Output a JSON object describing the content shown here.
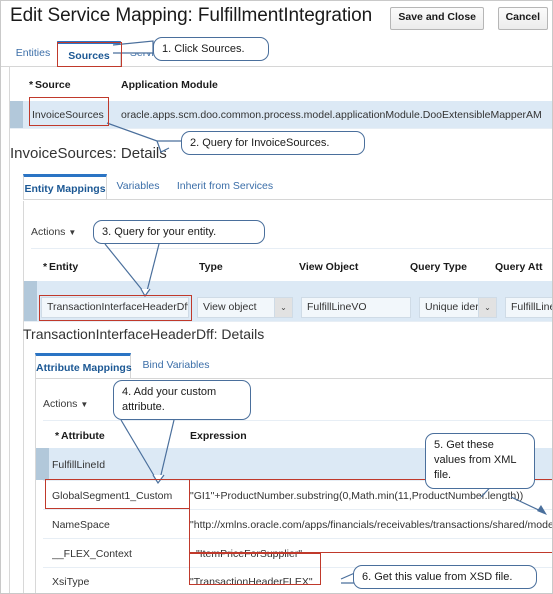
{
  "header": {
    "title": "Edit Service Mapping: FulfillmentIntegration",
    "save_label": "Save and Close",
    "cancel_label": "Cancel"
  },
  "main_tabs": [
    {
      "label": "Entities",
      "selected": false
    },
    {
      "label": "Sources",
      "selected": true
    },
    {
      "label": "Services",
      "selected": false
    }
  ],
  "sources_grid": {
    "headers": {
      "star": "*",
      "source": "Source",
      "application_module": "Application Module"
    },
    "rows": [
      {
        "source": "InvoiceSources",
        "application_module": "oracle.apps.scm.doo.common.process.model.applicationModule.DooExtensibleMapperAM"
      }
    ]
  },
  "source_details": {
    "subtitle": "InvoiceSources: Details",
    "tabs": [
      {
        "label": "Entity Mappings",
        "selected": true
      },
      {
        "label": "Variables",
        "selected": false
      },
      {
        "label": "Inherit from Services",
        "selected": false
      }
    ],
    "actions_label": "Actions",
    "actions_caret": "▼",
    "headers": {
      "star": "*",
      "entity": "Entity",
      "type": "Type",
      "view_object": "View Object",
      "query_type": "Query Type",
      "query_attribute": "Query Att"
    },
    "row": {
      "entity": "TransactionInterfaceHeaderDff",
      "type": "View object",
      "type_arrow": "⌄",
      "view_object": "FulfillLineVO",
      "query_type": "Unique ider",
      "query_type_arrow": "⌄",
      "query_attribute": "FulfillLine"
    }
  },
  "entity_details": {
    "subtitle": "TransactionInterfaceHeaderDff: Details",
    "tabs": [
      {
        "label": "Attribute Mappings",
        "selected": true
      },
      {
        "label": "Bind Variables",
        "selected": false
      }
    ],
    "actions_label": "Actions",
    "actions_caret": "▼",
    "headers": {
      "star": "*",
      "attribute": "Attribute",
      "expression": "Expression"
    },
    "rows": [
      {
        "attribute": "FulfillLineId",
        "expression": "",
        "selected": true
      },
      {
        "attribute": "GlobalSegment1_Custom",
        "expression": "\"GI1\"+ProductNumber.substring(0,Math.min(11,ProductNumber.length))",
        "selected": false
      },
      {
        "attribute": "NameSpace",
        "expression": "\"http://xmlns.oracle.com/apps/financials/receivables/transactions/shared/model",
        "selected": false
      },
      {
        "attribute": "__FLEX_Context",
        "expression": "\"ItemPriceForSupplier\"",
        "selected": false
      },
      {
        "attribute": "XsiType",
        "expression": "\"TransactionHeaderFLEX\"",
        "selected": false
      }
    ]
  },
  "annotations": {
    "callouts": [
      {
        "id": "c1",
        "text": "1. Click Sources."
      },
      {
        "id": "c2",
        "text": "2. Query for InvoiceSources."
      },
      {
        "id": "c3",
        "text": "3. Query for your entity."
      },
      {
        "id": "c4",
        "text": "4. Add your custom attribute."
      },
      {
        "id": "c5",
        "text": "5. Get these values from XML file."
      },
      {
        "id": "c6",
        "text": "6. Get this value from XSD file."
      }
    ],
    "highlight_color": "#c0392b",
    "callout_border_color": "#4a6f9c"
  }
}
